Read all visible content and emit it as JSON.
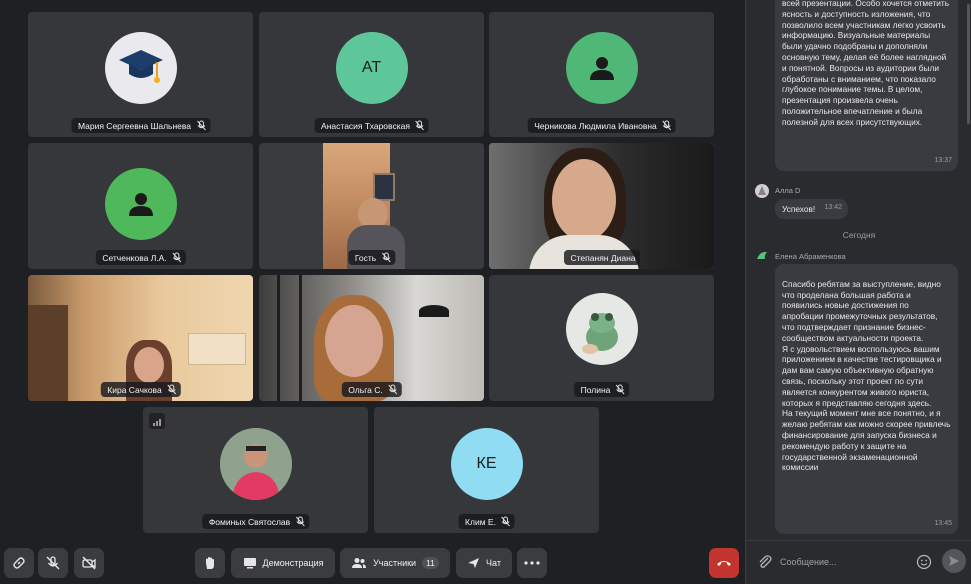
{
  "participants": [
    {
      "name": "Мария Сергеевна Шальнева",
      "avatar": "graduation-cap-icon"
    },
    {
      "name": "Анастасия Тхаровская",
      "initials": "АТ",
      "color": "#5ec79a"
    },
    {
      "name": "Черникова Людмила Ивановна",
      "avatar": "person-icon",
      "color": "#4fb877"
    },
    {
      "name": "Сетченкова Л.А.",
      "avatar": "person-icon",
      "color": "#4fb85a"
    },
    {
      "name": "Гость",
      "video": true
    },
    {
      "name": "Степанян Диана",
      "video": true,
      "active": true
    },
    {
      "name": "Кира Сачкова",
      "video": true
    },
    {
      "name": "Ольга С.",
      "video": true
    },
    {
      "name": "Полина",
      "avatar": "frog-photo"
    },
    {
      "name": "Фоминых Святослав",
      "avatar": "person-photo"
    },
    {
      "name": "Клим Е.",
      "initials": "КЕ",
      "color": "#8fdcf3"
    }
  ],
  "chat": {
    "messages": [
      {
        "text": "всей презентации. Особо хочется отметить ясность и доступность изложения, что позволило всем участникам легко усвоить информацию. Визуальные материалы были удачно подобраны и дополняли основную тему, делая её более наглядной и понятной. Вопросы из аудитории были обработаны с вниманием, что показало глубокое понимание темы. В целом, презентация произвела очень положительное впечатление и была полезной для всех присутствующих.",
        "time": "13:37"
      },
      {
        "author": "Алла D",
        "text": "Успехов!",
        "time": "13:42"
      },
      {
        "author": "Елена Абраменкова",
        "text": "Спасибо ребятам за выступление, видно что проделана большая работа и появились новые достижения по апробации промежуточных результатов, что подтверждает признание бизнес-сообществом актуальности проекта.\nЯ с удовольствием  воспользуюсь вашим  приложением в качестве тестировщика и дам вам самую объективную обратную связь, поскольку этот проект по сути является конкурентом живого юриста, которых я представляю сегодня здесь.\nНа текущий момент мне все понятно, и я желаю ребятам как можно скорее привлечь финансирование для запуска бизнеса и рекомендую работу к защите на государственной экзаменационной комиссии",
        "time": "13:45"
      }
    ],
    "day_separator": "Сегодня",
    "composer_placeholder": "Сообщение..."
  },
  "toolbar": {
    "screen_share_label": "Демонстрация",
    "participants_label": "Участники",
    "participants_count": "11",
    "chat_label": "Чат"
  },
  "colors": {
    "active_speaker": "#4ddf6f",
    "hangup": "#c3342f"
  }
}
